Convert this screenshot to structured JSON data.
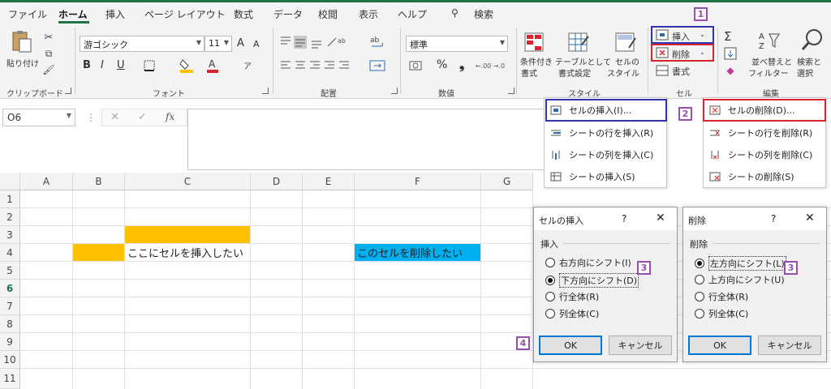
{
  "tabs": [
    "ファイル",
    "ホーム",
    "挿入",
    "ページ レイアウト",
    "数式",
    "データ",
    "校閲",
    "表示",
    "ヘルプ"
  ],
  "search_label": "検索",
  "ribbon": {
    "clipboard": {
      "paste": "貼り付け",
      "group": "クリップボード"
    },
    "font": {
      "name": "游ゴシック",
      "size": "11",
      "group": "フォント",
      "bold": "B",
      "italic": "I",
      "underline": "U",
      "grow": "A",
      "shrink": "A"
    },
    "alignment": {
      "group": "配置"
    },
    "number": {
      "format": "標準",
      "group": "数値",
      "percent": "%"
    },
    "styles": {
      "conditional": [
        "条件付き",
        "書式"
      ],
      "table": [
        "テーブルとして",
        "書式設定"
      ],
      "cell": [
        "セルの",
        "スタイル"
      ],
      "group": "スタイル"
    },
    "cells": {
      "insert": "挿入",
      "delete": "削除",
      "format": "書式",
      "group": "セル"
    },
    "editing": {
      "sum": "Σ",
      "sort": [
        "並べ替えと",
        "フィルター"
      ],
      "find": [
        "検索と",
        "選択"
      ],
      "group": "編集"
    }
  },
  "formula_bar": {
    "namebox": "O6",
    "fx": "fx"
  },
  "insert_menu": [
    "セルの挿入(I)...",
    "シートの行を挿入(R)",
    "シートの列を挿入(C)",
    "シートの挿入(S)"
  ],
  "delete_menu": [
    "セルの削除(D)...",
    "シートの行を削除(R)",
    "シートの列を削除(C)",
    "シートの削除(S)"
  ],
  "columns": [
    "A",
    "B",
    "C",
    "D",
    "E",
    "F",
    "G"
  ],
  "rows": [
    "1",
    "2",
    "3",
    "4",
    "5",
    "6",
    "7",
    "8",
    "9",
    "10",
    "11"
  ],
  "cells": {
    "c4": "ここにセルを挿入したい",
    "f4": "このセルを削除したい"
  },
  "insert_dialog": {
    "title": "セルの挿入",
    "help": "?",
    "section": "挿入",
    "options": [
      "右方向にシフト(I)",
      "下方向にシフト(D)",
      "行全体(R)",
      "列全体(C)"
    ],
    "selected": 1,
    "ok": "OK",
    "cancel": "キャンセル"
  },
  "delete_dialog": {
    "title": "削除",
    "help": "?",
    "section": "削除",
    "options": [
      "左方向にシフト(L)",
      "上方向にシフト(U)",
      "行全体(R)",
      "列全体(C)"
    ],
    "selected": 0,
    "ok": "OK",
    "cancel": "キャンセル"
  },
  "step_numbers": [
    "1",
    "2",
    "3",
    "3",
    "4"
  ],
  "colors": {
    "accent": "#217346",
    "orange": "#ffc000",
    "blue": "#00b0f0",
    "highlight_blue": "#3333aa",
    "highlight_red": "#d9232e",
    "step": "#9a4cb0"
  }
}
